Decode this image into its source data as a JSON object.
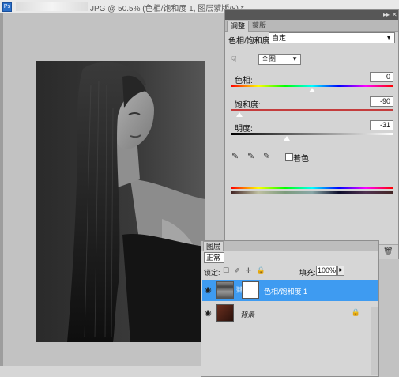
{
  "document": {
    "title": "JPG @ 50.5% (色相/饱和度 1, 图层蒙版/8) *"
  },
  "adjustments_panel": {
    "tabs": [
      "调整",
      "蒙版"
    ],
    "panel_title": "色相/饱和度",
    "preset_value": "自定",
    "channel_value": "全图",
    "hue": {
      "label": "色相:",
      "value": "0",
      "position": 0.5
    },
    "saturation": {
      "label": "饱和度:",
      "value": "-90",
      "position": 0.05
    },
    "lightness": {
      "label": "明度:",
      "value": "-31",
      "position": 0.345
    },
    "colorize_label": "着色",
    "colors": {
      "hue_spectrum": [
        "#ff0000",
        "#ffff00",
        "#00ff00",
        "#00ffff",
        "#0000ff",
        "#ff00ff",
        "#ff0000"
      ],
      "saturation_track": "#c43c3c",
      "lightness_track_from": "#000000",
      "lightness_track_to": "#ffffff"
    }
  },
  "layers_panel": {
    "tab_label": "图层",
    "blend_mode": "正常",
    "lock_label": "锁定:",
    "fill_label": "填充:",
    "fill_value": "100%",
    "layers": [
      {
        "name": "色相/饱和度 1",
        "selected": true
      },
      {
        "name": "背景",
        "selected": false,
        "locked": true
      }
    ],
    "colors": {
      "selection": "#3e9bf1"
    }
  },
  "icons": {
    "ps_icon": "photoshop-icon",
    "tools": [
      "target-adjust-icon",
      "eyedropper-icon",
      "eyedropper-plus-icon",
      "eyedropper-minus-icon"
    ]
  }
}
